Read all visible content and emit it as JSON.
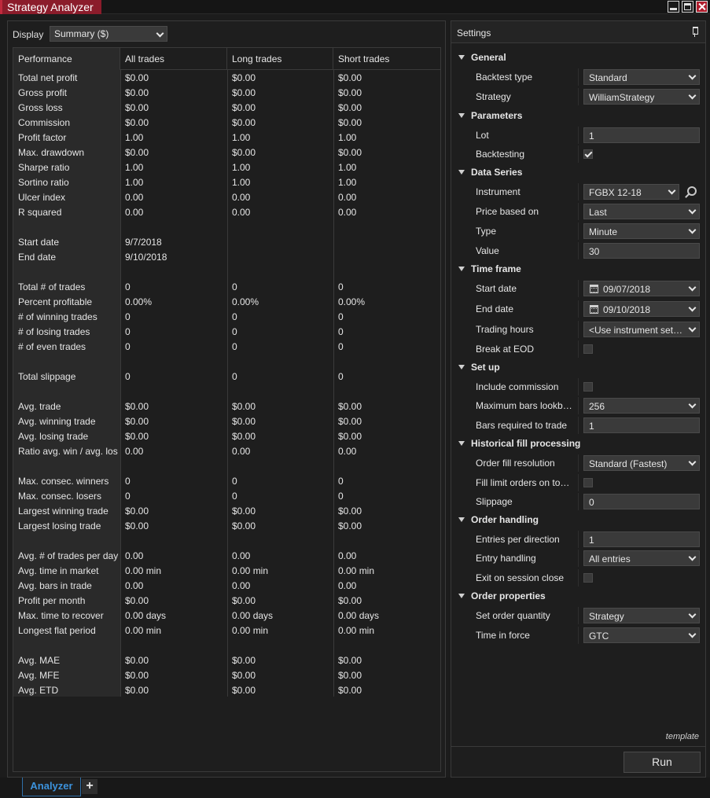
{
  "window": {
    "title": "Strategy Analyzer"
  },
  "display": {
    "label": "Display",
    "value": "Summary ($)"
  },
  "performance": {
    "headers": [
      "Performance",
      "All trades",
      "Long trades",
      "Short trades"
    ],
    "rows": [
      [
        "Total net profit",
        "$0.00",
        "$0.00",
        "$0.00"
      ],
      [
        "Gross profit",
        "$0.00",
        "$0.00",
        "$0.00"
      ],
      [
        "Gross loss",
        "$0.00",
        "$0.00",
        "$0.00"
      ],
      [
        "Commission",
        "$0.00",
        "$0.00",
        "$0.00"
      ],
      [
        "Profit factor",
        "1.00",
        "1.00",
        "1.00"
      ],
      [
        "Max. drawdown",
        "$0.00",
        "$0.00",
        "$0.00"
      ],
      [
        "Sharpe ratio",
        "1.00",
        "1.00",
        "1.00"
      ],
      [
        "Sortino ratio",
        "1.00",
        "1.00",
        "1.00"
      ],
      [
        "Ulcer index",
        "0.00",
        "0.00",
        "0.00"
      ],
      [
        "R squared",
        "0.00",
        "0.00",
        "0.00"
      ],
      [
        "",
        "",
        "",
        ""
      ],
      [
        "Start date",
        "9/7/2018",
        "",
        ""
      ],
      [
        "End date",
        "9/10/2018",
        "",
        ""
      ],
      [
        "",
        "",
        "",
        ""
      ],
      [
        "Total # of trades",
        "0",
        "0",
        "0"
      ],
      [
        "Percent profitable",
        "0.00%",
        "0.00%",
        "0.00%"
      ],
      [
        "# of winning trades",
        "0",
        "0",
        "0"
      ],
      [
        "# of losing trades",
        "0",
        "0",
        "0"
      ],
      [
        "# of even trades",
        "0",
        "0",
        "0"
      ],
      [
        "",
        "",
        "",
        ""
      ],
      [
        "Total slippage",
        "0",
        "0",
        "0"
      ],
      [
        "",
        "",
        "",
        ""
      ],
      [
        "Avg. trade",
        "$0.00",
        "$0.00",
        "$0.00"
      ],
      [
        "Avg. winning trade",
        "$0.00",
        "$0.00",
        "$0.00"
      ],
      [
        "Avg. losing trade",
        "$0.00",
        "$0.00",
        "$0.00"
      ],
      [
        "Ratio avg. win / avg. los",
        "0.00",
        "0.00",
        "0.00"
      ],
      [
        "",
        "",
        "",
        ""
      ],
      [
        "Max. consec. winners",
        "0",
        "0",
        "0"
      ],
      [
        "Max. consec. losers",
        "0",
        "0",
        "0"
      ],
      [
        "Largest winning trade",
        "$0.00",
        "$0.00",
        "$0.00"
      ],
      [
        "Largest losing trade",
        "$0.00",
        "$0.00",
        "$0.00"
      ],
      [
        "",
        "",
        "",
        ""
      ],
      [
        "Avg. # of trades per day",
        "0.00",
        "0.00",
        "0.00"
      ],
      [
        "Avg. time in market",
        "0.00 min",
        "0.00 min",
        "0.00 min"
      ],
      [
        "Avg. bars in trade",
        "0.00",
        "0.00",
        "0.00"
      ],
      [
        "Profit per month",
        "$0.00",
        "$0.00",
        "$0.00"
      ],
      [
        "Max. time to recover",
        "0.00 days",
        "0.00 days",
        "0.00 days"
      ],
      [
        "Longest flat period",
        "0.00 min",
        "0.00 min",
        "0.00 min"
      ],
      [
        "",
        "",
        "",
        ""
      ],
      [
        "Avg. MAE",
        "$0.00",
        "$0.00",
        "$0.00"
      ],
      [
        "Avg. MFE",
        "$0.00",
        "$0.00",
        "$0.00"
      ],
      [
        "Avg. ETD",
        "$0.00",
        "$0.00",
        "$0.00"
      ]
    ]
  },
  "settings": {
    "title": "Settings",
    "template_label": "template",
    "run_label": "Run",
    "sections": [
      {
        "name": "General",
        "items": [
          {
            "label": "Backtest type",
            "type": "dropdown",
            "value": "Standard"
          },
          {
            "label": "Strategy",
            "type": "dropdown",
            "value": "WilliamStrategy"
          }
        ]
      },
      {
        "name": "Parameters",
        "items": [
          {
            "label": "Lot",
            "type": "input",
            "value": "1"
          },
          {
            "label": "Backtesting",
            "type": "checkbox",
            "checked": true
          }
        ]
      },
      {
        "name": "Data Series",
        "items": [
          {
            "label": "Instrument",
            "type": "instrument",
            "value": "FGBX 12-18"
          },
          {
            "label": "Price based on",
            "type": "dropdown",
            "value": "Last"
          },
          {
            "label": "Type",
            "type": "dropdown",
            "value": "Minute"
          },
          {
            "label": "Value",
            "type": "input",
            "value": "30"
          }
        ]
      },
      {
        "name": "Time frame",
        "items": [
          {
            "label": "Start date",
            "type": "date",
            "value": "09/07/2018"
          },
          {
            "label": "End date",
            "type": "date",
            "value": "09/10/2018"
          },
          {
            "label": "Trading hours",
            "type": "dropdown",
            "value": "<Use instrument settings>"
          },
          {
            "label": "Break at EOD",
            "type": "checkbox",
            "checked": false
          }
        ]
      },
      {
        "name": "Set up",
        "items": [
          {
            "label": "Include commission",
            "type": "checkbox",
            "checked": false
          },
          {
            "label": "Maximum bars lookback",
            "type": "dropdown",
            "value": "256"
          },
          {
            "label": "Bars required to trade",
            "type": "input",
            "value": "1"
          }
        ]
      },
      {
        "name": "Historical fill processing",
        "items": [
          {
            "label": "Order fill resolution",
            "type": "dropdown",
            "value": "Standard (Fastest)"
          },
          {
            "label": "Fill limit orders on touch",
            "type": "checkbox",
            "checked": false
          },
          {
            "label": "Slippage",
            "type": "input",
            "value": "0"
          }
        ]
      },
      {
        "name": "Order handling",
        "items": [
          {
            "label": "Entries per direction",
            "type": "input",
            "value": "1"
          },
          {
            "label": "Entry handling",
            "type": "dropdown",
            "value": "All entries"
          },
          {
            "label": "Exit on session close",
            "type": "checkbox",
            "checked": false
          }
        ]
      },
      {
        "name": "Order properties",
        "items": [
          {
            "label": "Set order quantity",
            "type": "dropdown",
            "value": "Strategy"
          },
          {
            "label": "Time in force",
            "type": "dropdown",
            "value": "GTC"
          }
        ]
      }
    ]
  },
  "tabs": {
    "active": "Analyzer",
    "add_label": "+"
  }
}
